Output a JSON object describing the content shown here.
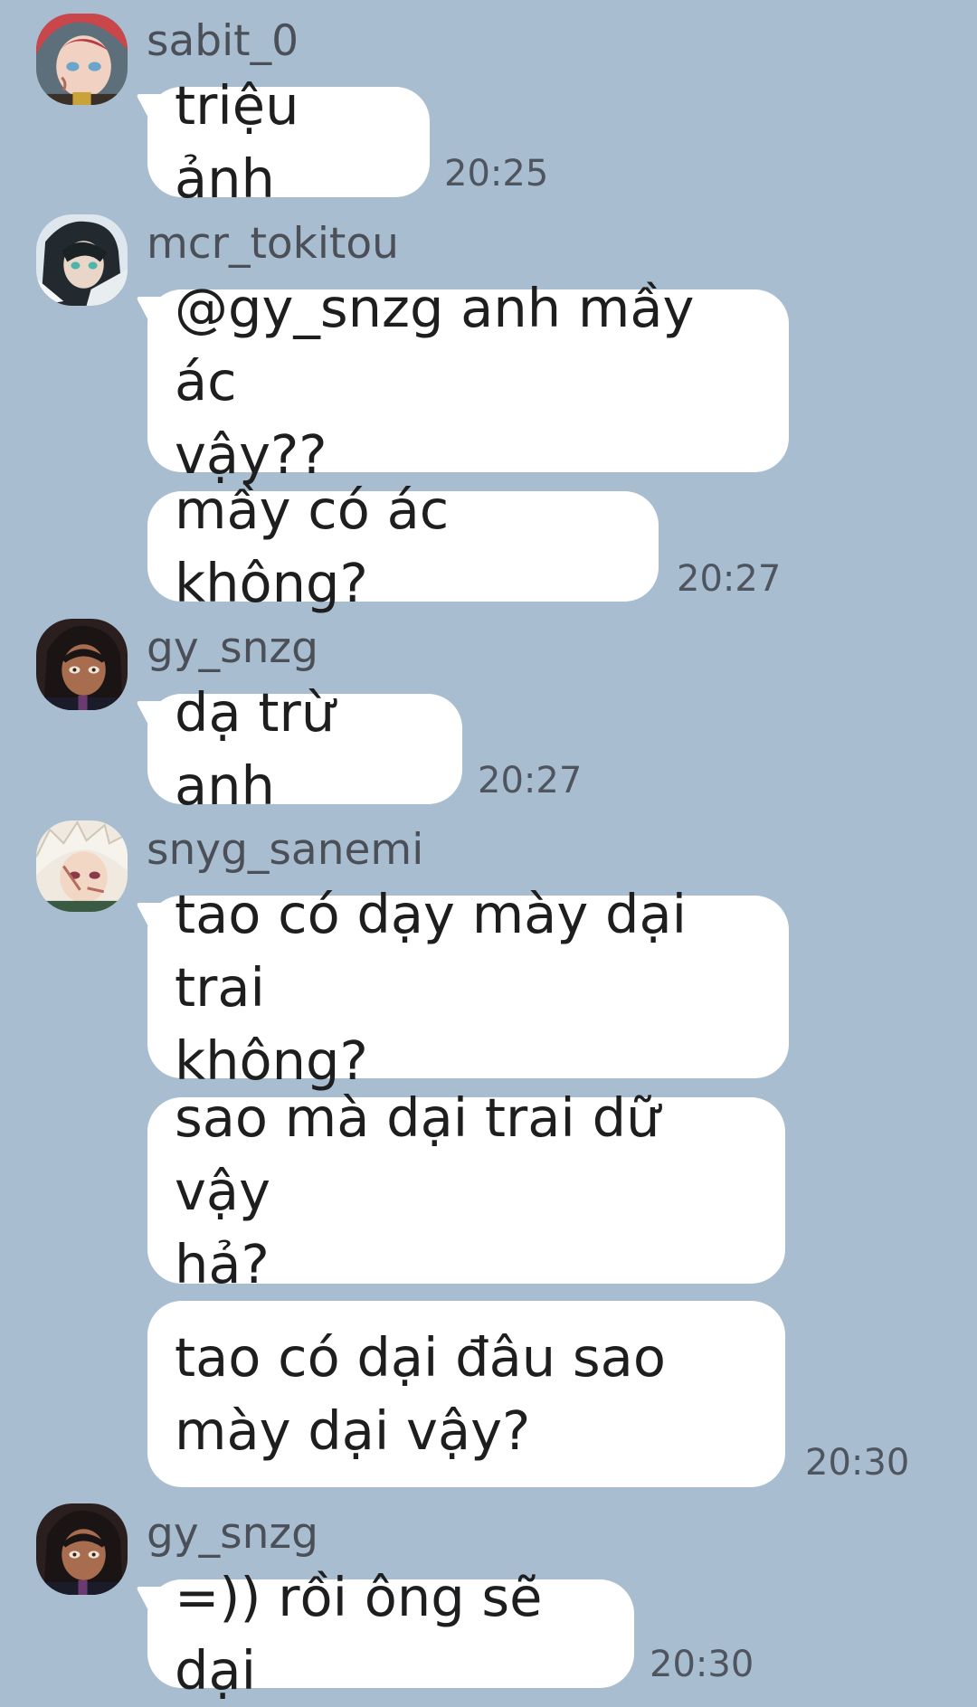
{
  "chat": {
    "groups": [
      {
        "username": "sabit_0",
        "avatar": "anime-avatar-sabito",
        "messages": [
          {
            "text": "triệu ảnh"
          }
        ],
        "time": "20:25"
      },
      {
        "username": "mcr_tokitou",
        "avatar": "anime-avatar-tokitou",
        "messages": [
          {
            "text": "@gy_snzg anh mầy ác\nvậy??"
          },
          {
            "text": "mầy có ác không?"
          }
        ],
        "time": "20:27"
      },
      {
        "username": "gy_snzg",
        "avatar": "anime-avatar-genya",
        "messages": [
          {
            "text": "dạ trừ anh"
          }
        ],
        "time": "20:27"
      },
      {
        "username": "snyg_sanemi",
        "avatar": "anime-avatar-sanemi",
        "messages": [
          {
            "text": "tao có dạy mày dại trai\nkhông?"
          },
          {
            "text": "sao mà dại trai dữ vậy\nhả?"
          },
          {
            "text": "tao có dại đâu sao\nmày dại vậy?"
          }
        ],
        "time": "20:30"
      },
      {
        "username": "gy_snzg",
        "avatar": "anime-avatar-genya",
        "messages": [
          {
            "text": "=)) rồi ông sẽ dại"
          }
        ],
        "time": "20:30"
      }
    ]
  },
  "colors": {
    "background": "#a9bdd1",
    "bubble": "#ffffff",
    "username": "#4b4f57",
    "timestamp": "#4f555e"
  }
}
